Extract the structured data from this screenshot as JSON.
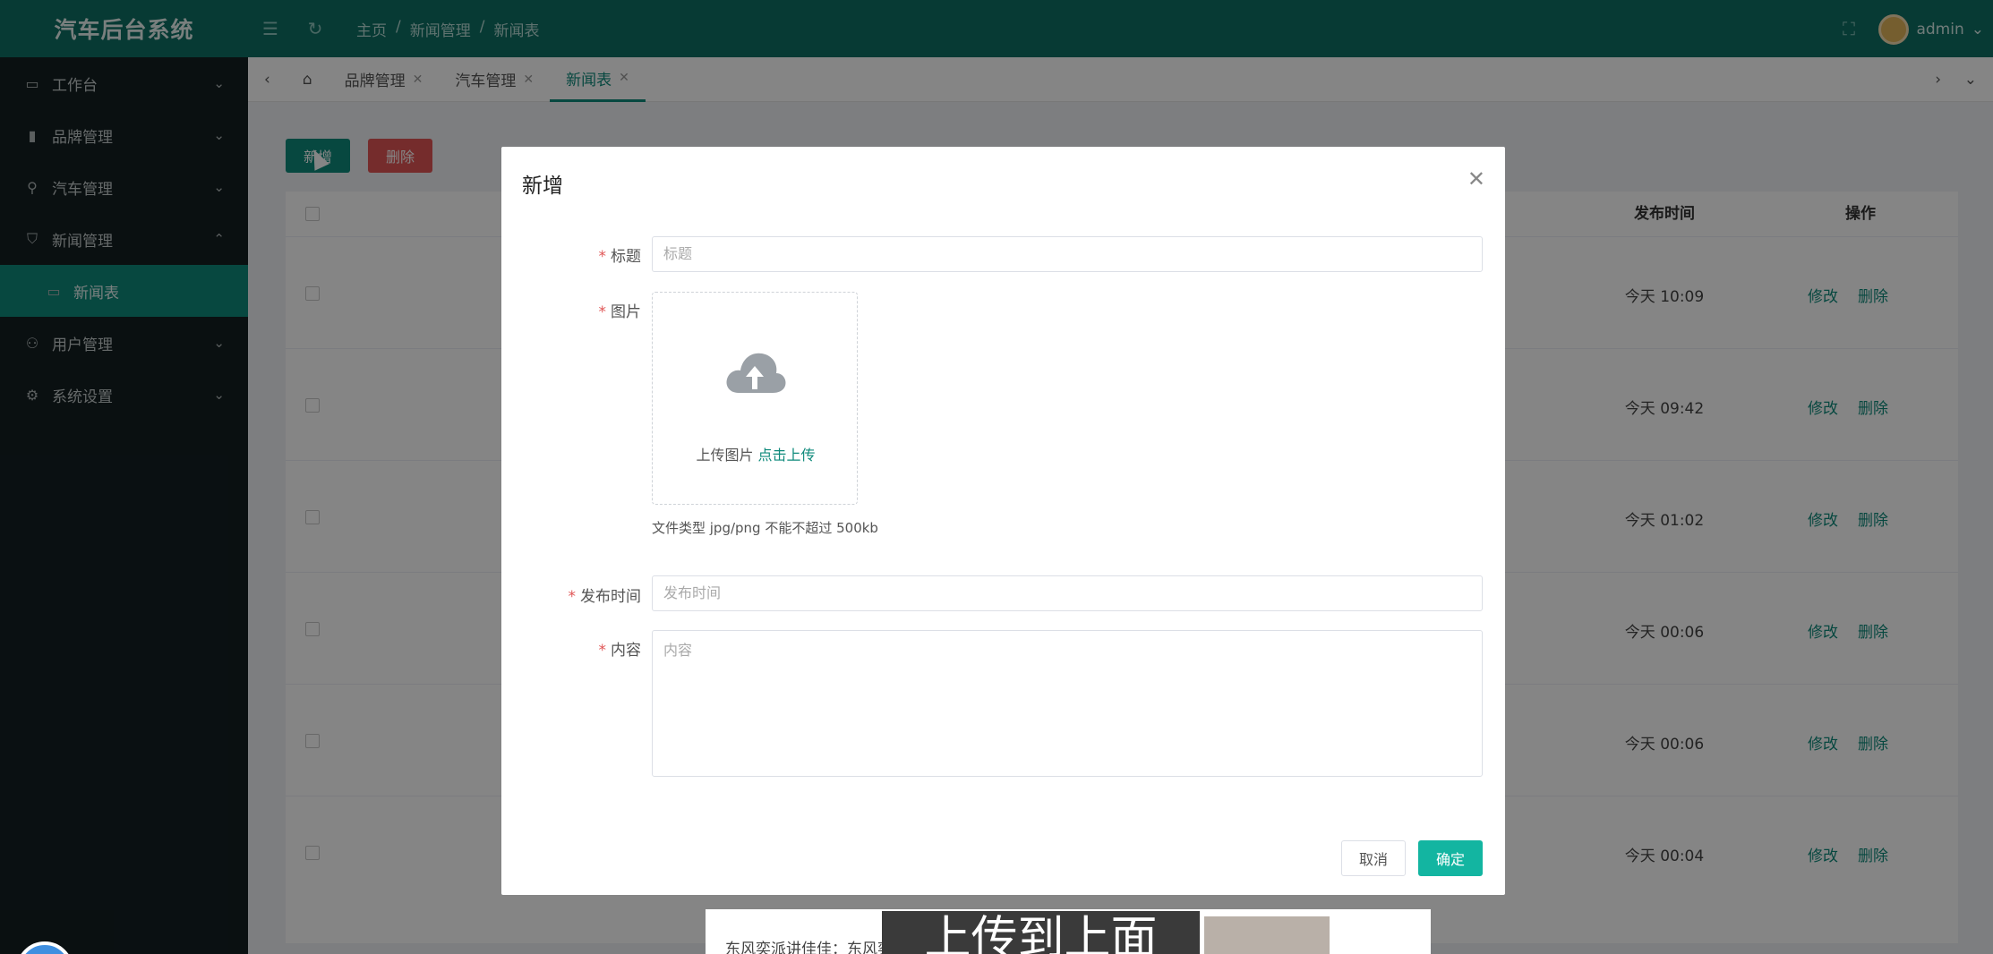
{
  "app": {
    "title": "汽车后台系统"
  },
  "header": {
    "breadcrumb": [
      "主页",
      "新闻管理",
      "新闻表"
    ],
    "breadcrumb_sep": "/",
    "user": "admin"
  },
  "sidebar": {
    "items": [
      {
        "label": "工作台",
        "icon": "monitor-icon"
      },
      {
        "label": "品牌管理",
        "icon": "document-icon"
      },
      {
        "label": "汽车管理",
        "icon": "car-icon"
      },
      {
        "label": "新闻管理",
        "icon": "shield-icon"
      },
      {
        "label": "新闻表",
        "icon": "monitor-icon"
      },
      {
        "label": "用户管理",
        "icon": "user-icon"
      },
      {
        "label": "系统设置",
        "icon": "gear-icon"
      }
    ]
  },
  "tabs": [
    {
      "label": "品牌管理"
    },
    {
      "label": "汽车管理"
    },
    {
      "label": "新闻表"
    }
  ],
  "toolbar": {
    "add_label": "新增",
    "delete_label": "删除"
  },
  "table": {
    "columns": {
      "time": "发布时间",
      "actions": "操作"
    },
    "rows": [
      {
        "time": "今天 10:09"
      },
      {
        "time": "今天 09:42"
      },
      {
        "time": "今天 01:02"
      },
      {
        "time": "今天 00:06"
      },
      {
        "time": "今天 00:06"
      },
      {
        "time": "今天 00:04"
      }
    ],
    "edit_label": "修改",
    "delete_label": "删除"
  },
  "modal": {
    "title": "新增",
    "title_label": "标题",
    "title_placeholder": "标题",
    "image_label": "图片",
    "upload_text": "上传图片",
    "upload_link": "点击上传",
    "upload_tip": "文件类型 jpg/png 不能不超过 500kb",
    "time_label": "发布时间",
    "time_placeholder": "发布时间",
    "content_label": "内容",
    "content_placeholder": "内容",
    "cancel_label": "取消",
    "ok_label": "确定"
  },
  "bottom": {
    "partial_text": "东风奕派讲佳佳：东风奕派",
    "subtitle": "上传到上面"
  },
  "colors": {
    "primary": "#0e8a7b",
    "danger": "#e05555",
    "header": "#0e6f64",
    "sidebar": "#141f22"
  }
}
